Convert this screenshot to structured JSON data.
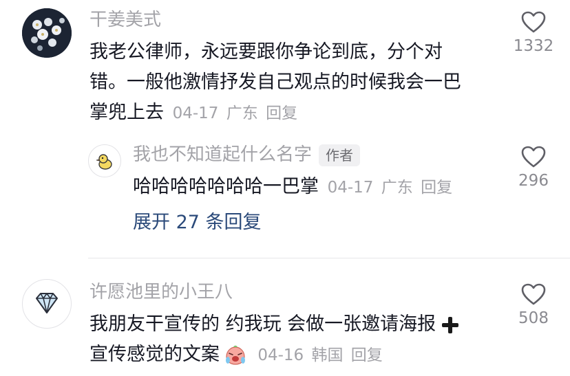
{
  "comments": [
    {
      "username": "干姜美式",
      "text": "我老公律师，永远要跟你争论到底，分个对错。一般他激情抒发自己观点的时候我会一巴掌兜上去",
      "line1": "我老公律师，永远要跟你争论到底，分个对",
      "line2": "错。一般他激情抒发自己观点的时候我会一巴",
      "line3": "掌兜上去",
      "date": "04-17",
      "location": "广东",
      "reply_label": "回复",
      "likes": "1332",
      "avatar_icon": "flower-photo-avatar"
    },
    {
      "username": "我也不知道起什么名字",
      "author_tag": "作者",
      "text": "哈哈哈哈哈哈哈一巴掌",
      "date": "04-17",
      "location": "广东",
      "reply_label": "回复",
      "likes": "296",
      "avatar_icon": "duck-avatar"
    },
    {
      "username": "许愿池里的小王八",
      "line1": "我朋友干宣传的 约我玩 会做一张邀请海报",
      "line2": "宣传感觉的文案",
      "date": "04-16",
      "location": "韩国",
      "reply_label": "回复",
      "likes": "508",
      "avatar_icon": "diamond-avatar"
    }
  ],
  "expand_replies": "展开 27 条回复",
  "colors": {
    "muted": "#a3a3a8",
    "text": "#161823",
    "link": "#2b4a7a",
    "divider": "#e6e6e9"
  }
}
